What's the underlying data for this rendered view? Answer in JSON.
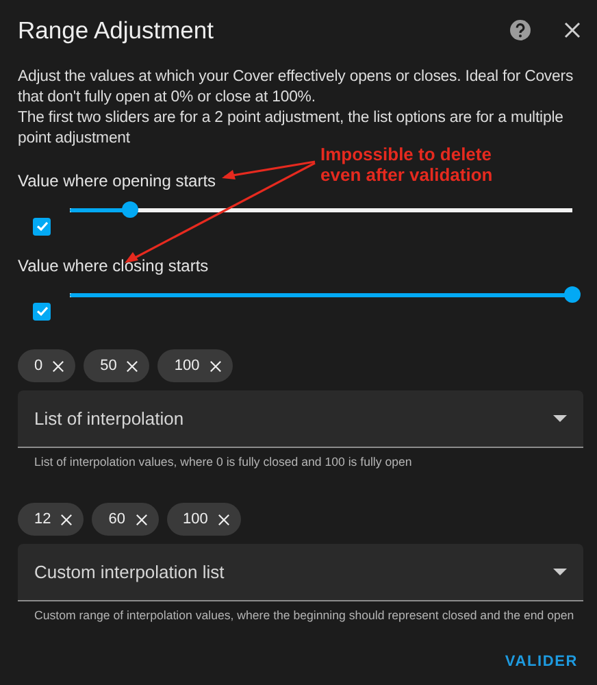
{
  "dialog": {
    "title": "Range Adjustment",
    "description": [
      "Adjust the values at which your Cover effectively opens or closes. Ideal for Covers that don't fully open at 0% or close at 100%.",
      "The first two sliders are for a 2 point adjustment, the list options are for a multiple point adjustment"
    ],
    "sliders": [
      {
        "label": "Value where opening starts",
        "checked": true,
        "level": 0.12
      },
      {
        "label": "Value where closing starts",
        "checked": true,
        "level": 1
      }
    ],
    "lists": [
      {
        "chips": [
          "0",
          "50",
          "100"
        ],
        "label": "List of interpolation",
        "helper": "List of interpolation values, where 0 is fully closed and 100 is fully open"
      },
      {
        "chips": [
          "12",
          "60",
          "100"
        ],
        "label": "Custom interpolation list",
        "helper": "Custom range of interpolation values, where the beginning should represent closed and the end open"
      }
    ],
    "button": "VALIDER"
  },
  "annotation": {
    "text": "Impossible to delete even after validation"
  }
}
